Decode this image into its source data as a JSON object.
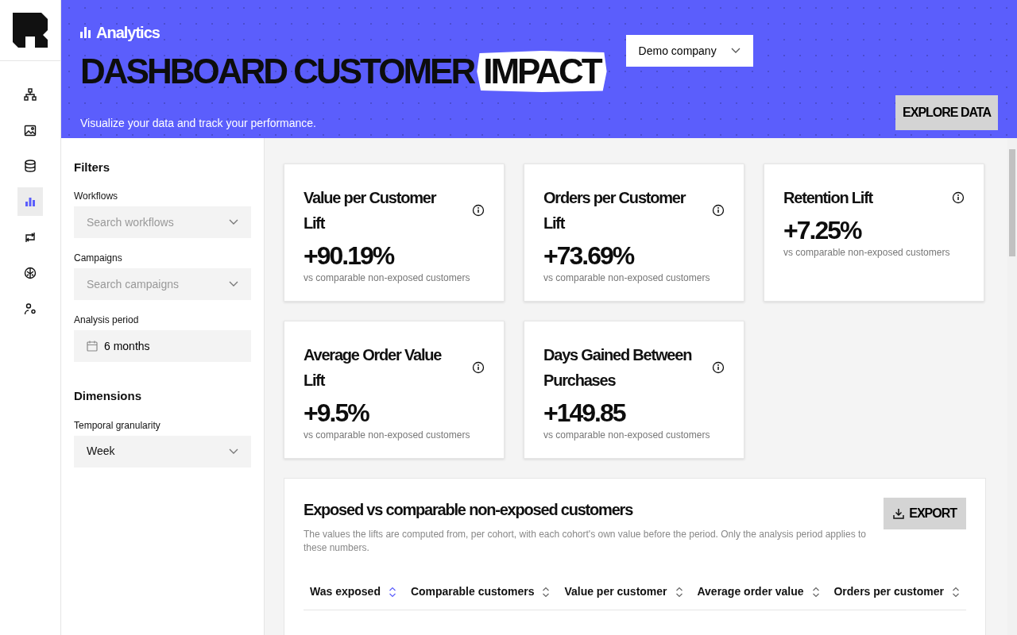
{
  "nav": [
    {
      "kind": "hierarchy",
      "selected": false
    },
    {
      "kind": "image",
      "selected": false
    },
    {
      "kind": "database",
      "selected": false
    },
    {
      "kind": "chart",
      "selected": true
    },
    {
      "kind": "repeat",
      "selected": false
    },
    {
      "kind": "brain",
      "selected": false
    },
    {
      "kind": "users",
      "selected": false
    }
  ],
  "header": {
    "section": "Analytics",
    "title": "DASHBOARD CUSTOMER",
    "title_highlight": "IMPACT",
    "subtitle": "Visualize your data and track your performance.",
    "company": "Demo company",
    "action": "EXPLORE DATA"
  },
  "filters": {
    "heading": "Filters",
    "fields": [
      {
        "label": "Workflows",
        "placeholder": "Search workflows",
        "kind": "select"
      },
      {
        "label": "Campaigns",
        "placeholder": "Search campaigns",
        "kind": "select"
      },
      {
        "label": "Analysis period",
        "value": "6 months",
        "kind": "date"
      }
    ]
  },
  "dimensions": {
    "heading": "Dimensions",
    "fields": [
      {
        "label": "Temporal granularity",
        "value": "Week",
        "kind": "select"
      }
    ]
  },
  "kpis": [
    {
      "title": "Value per Customer Lift",
      "value": "+90.19%",
      "note": "vs comparable non-exposed customers"
    },
    {
      "title": "Orders per Customer Lift",
      "value": "+73.69%",
      "note": "vs comparable non-exposed customers"
    },
    {
      "title": "Retention Lift",
      "value": "+7.25%",
      "note": "vs comparable non-exposed customers"
    },
    {
      "title": "Average Order Value Lift",
      "value": "+9.5%",
      "note": "vs comparable non-exposed customers"
    },
    {
      "title": "Days Gained Between Purchases",
      "value": "+149.85",
      "note": "vs comparable non-exposed customers"
    }
  ],
  "table": {
    "title": "Exposed vs comparable non-exposed customers",
    "description": "The values the lifts are computed from, per cohort, with each cohort's own value before the period. Only the analysis period applies to these numbers.",
    "export": "EXPORT",
    "columns": [
      {
        "label": "Was exposed",
        "selected": true
      },
      {
        "label": "Comparable customers",
        "selected": false
      },
      {
        "label": "Value per customer",
        "selected": false
      },
      {
        "label": "Average order value",
        "selected": false
      },
      {
        "label": "Orders per customer",
        "selected": false
      }
    ]
  }
}
